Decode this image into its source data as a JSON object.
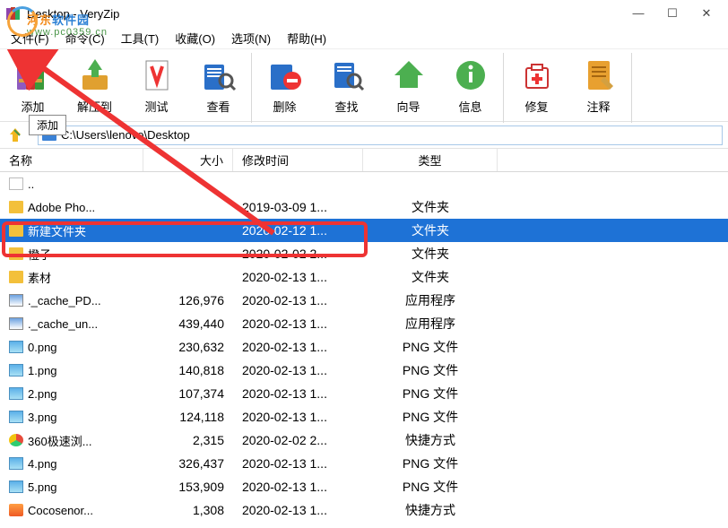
{
  "titlebar": {
    "title": "Desktop - VeryZip"
  },
  "menu": {
    "file": "文件(F)",
    "command": "命令(C)",
    "tools": "工具(T)",
    "favorites": "收藏(O)",
    "options": "选项(N)",
    "help": "帮助(H)"
  },
  "toolbar": {
    "add": "添加",
    "extract": "解压到",
    "test": "测试",
    "view": "查看",
    "delete": "删除",
    "find": "查找",
    "wizard": "向导",
    "info": "信息",
    "repair": "修复",
    "comment": "注释"
  },
  "tooltip": "添加",
  "path": "C:\\Users\\lenovo\\Desktop",
  "columns": {
    "name": "名称",
    "size": "大小",
    "date": "修改时间",
    "type": "类型"
  },
  "rows": [
    {
      "icon": "updir",
      "name": "..",
      "size": "",
      "date": "",
      "type": ""
    },
    {
      "icon": "folder",
      "name": "Adobe Pho...",
      "size": "",
      "date": "2019-03-09 1...",
      "type": "文件夹"
    },
    {
      "icon": "folder",
      "name": "新建文件夹",
      "size": "",
      "date": "2020-02-12 1...",
      "type": "文件夹",
      "selected": true
    },
    {
      "icon": "folder",
      "name": "橙子",
      "size": "",
      "date": "2020-02-02 2...",
      "type": "文件夹"
    },
    {
      "icon": "folder",
      "name": "素材",
      "size": "",
      "date": "2020-02-13 1...",
      "type": "文件夹"
    },
    {
      "icon": "exe",
      "name": "._cache_PD...",
      "size": "126,976",
      "date": "2020-02-13 1...",
      "type": "应用程序"
    },
    {
      "icon": "exe",
      "name": "._cache_un...",
      "size": "439,440",
      "date": "2020-02-13 1...",
      "type": "应用程序"
    },
    {
      "icon": "png",
      "name": "0.png",
      "size": "230,632",
      "date": "2020-02-13 1...",
      "type": "PNG 文件"
    },
    {
      "icon": "png",
      "name": "1.png",
      "size": "140,818",
      "date": "2020-02-13 1...",
      "type": "PNG 文件"
    },
    {
      "icon": "png",
      "name": "2.png",
      "size": "107,374",
      "date": "2020-02-13 1...",
      "type": "PNG 文件"
    },
    {
      "icon": "png",
      "name": "3.png",
      "size": "124,118",
      "date": "2020-02-13 1...",
      "type": "PNG 文件"
    },
    {
      "icon": "chrome",
      "name": "360极速浏...",
      "size": "2,315",
      "date": "2020-02-02 2...",
      "type": "快捷方式"
    },
    {
      "icon": "png",
      "name": "4.png",
      "size": "326,437",
      "date": "2020-02-13 1...",
      "type": "PNG 文件"
    },
    {
      "icon": "png",
      "name": "5.png",
      "size": "153,909",
      "date": "2020-02-13 1...",
      "type": "PNG 文件"
    },
    {
      "icon": "cs",
      "name": "Cocosenor...",
      "size": "1,308",
      "date": "2020-02-13 1...",
      "type": "快捷方式"
    }
  ],
  "watermark": {
    "main_left": "河东",
    "main_right": "软件园",
    "sub": "www.pc0359.cn"
  }
}
